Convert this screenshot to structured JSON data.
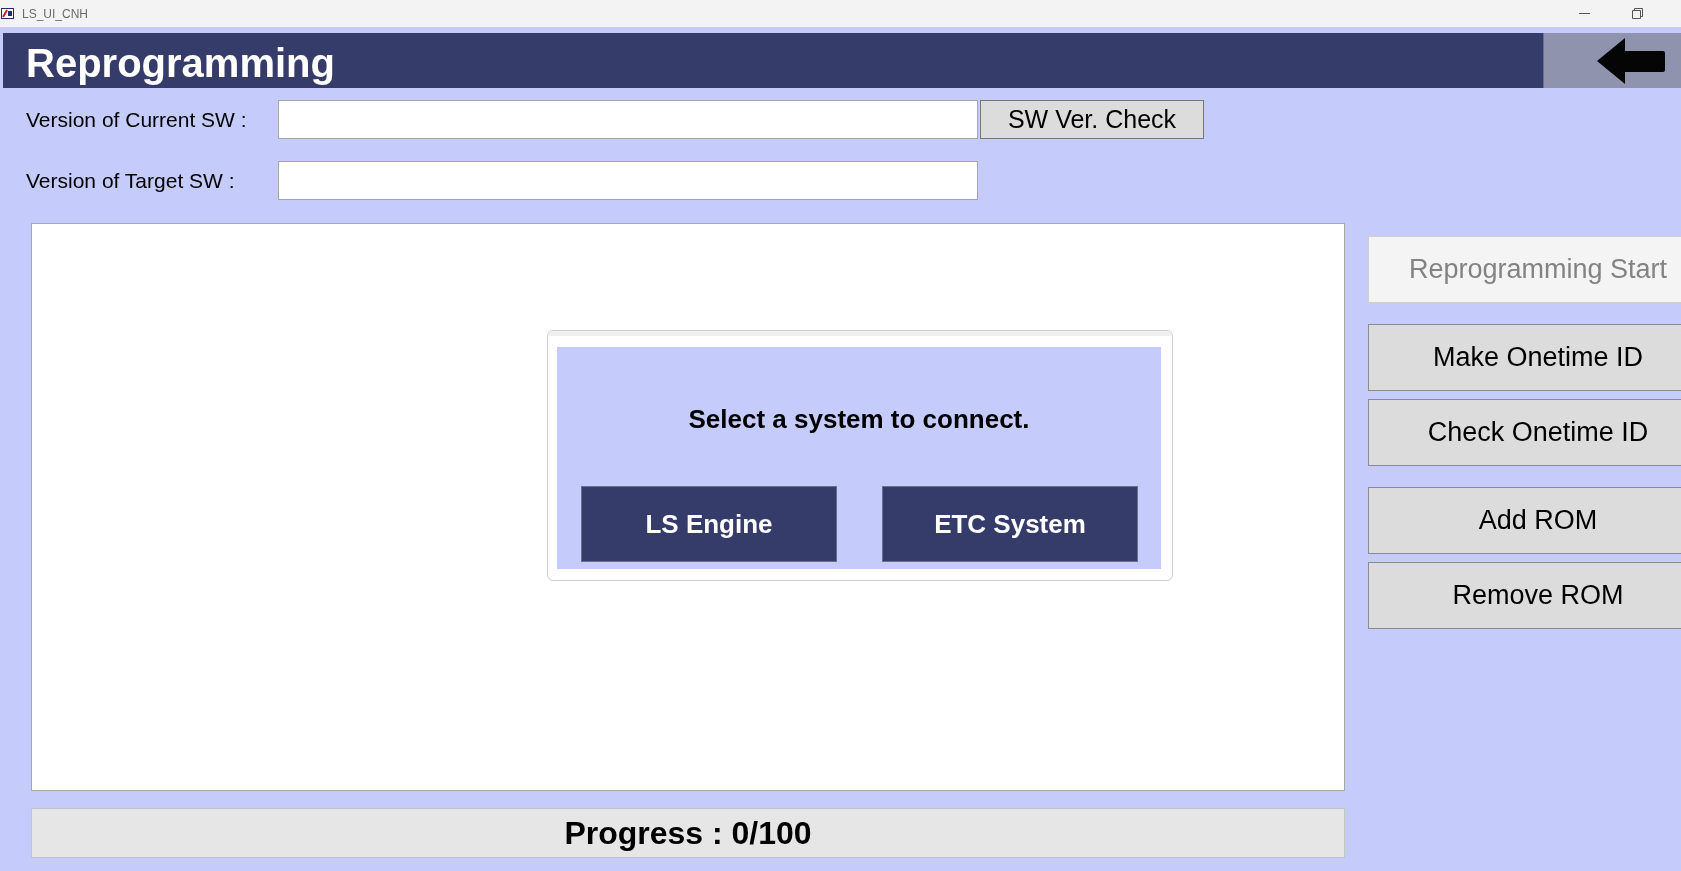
{
  "window": {
    "title": "LS_UI_CNH"
  },
  "header": {
    "title": "Reprogramming"
  },
  "version_fields": [
    {
      "label": "Version of Current SW :",
      "button": "SW Ver. Check"
    },
    {
      "label": "Version of Target SW :"
    }
  ],
  "dialog": {
    "message": "Select a system to connect.",
    "buttons": [
      "LS Engine",
      "ETC System"
    ]
  },
  "action_groups": [
    {
      "buttons": [
        {
          "label": "Reprogramming Start",
          "disabled": true
        }
      ]
    },
    {
      "buttons": [
        {
          "label": "Make Onetime ID",
          "disabled": false
        },
        {
          "label": "Check Onetime ID",
          "disabled": false
        }
      ]
    },
    {
      "buttons": [
        {
          "label": "Add ROM",
          "disabled": false
        },
        {
          "label": "Remove ROM",
          "disabled": false
        }
      ]
    }
  ],
  "progress": {
    "text": "Progress : 0/100"
  }
}
